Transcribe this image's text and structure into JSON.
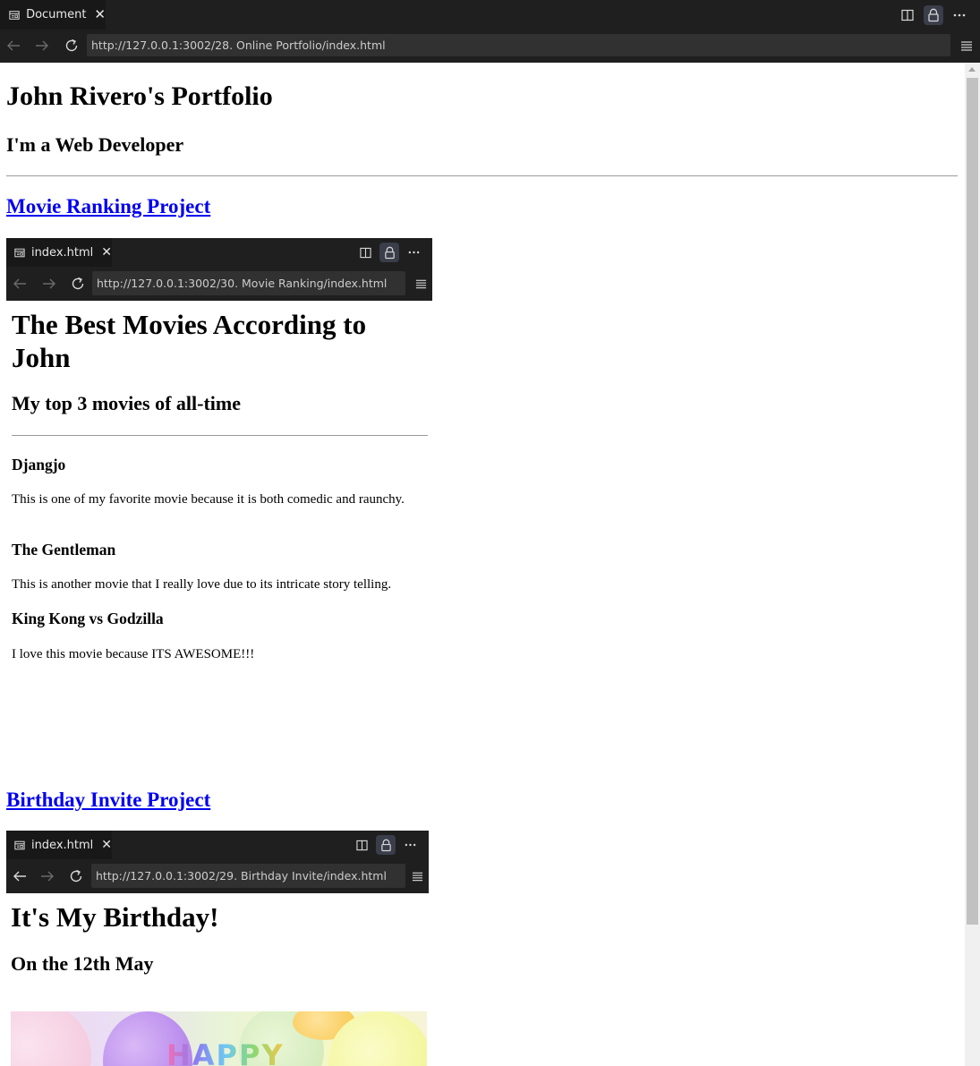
{
  "browser": {
    "tab_title": "Document",
    "url": "http://127.0.0.1:3002/28. Online Portfolio/index.html"
  },
  "page": {
    "title": "John Rivero's Portfolio",
    "subtitle": "I'm a Web Developer",
    "projects": [
      {
        "link_text": "Movie Ranking Project",
        "screenshot": {
          "tab_title": "index.html",
          "url": "http://127.0.0.1:3002/30. Movie Ranking/index.html",
          "title": "The Best Movies According to John",
          "subtitle": "My top 3 movies of all-time",
          "movies": [
            {
              "name": "Djangjo",
              "description": "This is one of my favorite movie because it is both comedic and raunchy."
            },
            {
              "name": "The Gentleman",
              "description": "This is another movie that I really love due to its intricate story telling."
            },
            {
              "name": "King Kong vs Godzilla",
              "description": "I love this movie because ITS AWESOME!!!"
            }
          ]
        }
      },
      {
        "link_text": "Birthday Invite Project",
        "screenshot": {
          "tab_title": "index.html",
          "url": "http://127.0.0.1:3002/29. Birthday Invite/index.html",
          "title": "It's My Birthday!",
          "subtitle": "On the 12th May",
          "image_text": "HAPPY"
        }
      }
    ]
  },
  "icons": {
    "tab": "page-icon",
    "split": "split-editor-icon",
    "lock": "lock-icon",
    "more": "more-icon",
    "back": "arrow-left-icon",
    "forward": "arrow-right-icon",
    "reload": "refresh-icon",
    "menu": "hamburger-menu-icon"
  },
  "colors": {
    "chrome_bg": "#1f1f1f",
    "tab_active_bg": "#181818",
    "url_bg": "#313131",
    "link": "#0000ee"
  }
}
